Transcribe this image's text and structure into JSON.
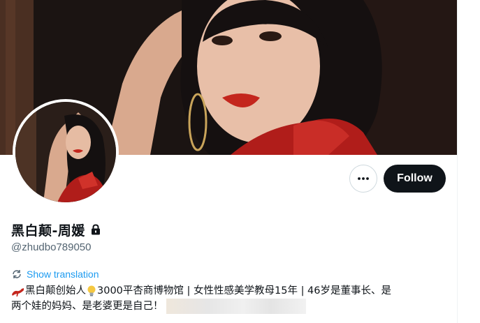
{
  "profile": {
    "display_name": "黑白颠-周媛",
    "handle": "@zhudbo789050",
    "follow_label": "Follow",
    "more_label": "More",
    "translate_label": "Show translation",
    "bio": {
      "line1_part1": "黑白颠创始人",
      "line1_part2": "3000平杏商博物馆 | 女性性感美学教母15年 | 46岁是董事长、是",
      "line2": "两个娃的妈妈、是老婆更是自己！"
    }
  },
  "icons": {
    "protected": "lock-icon",
    "more": "ellipsis-icon",
    "translate": "translate-icon",
    "shoe": "high-heel-icon",
    "bulb": "light-bulb-icon"
  },
  "colors": {
    "follow_bg": "#0f1419",
    "link": "#1d9bf0",
    "secondary_text": "#536471"
  }
}
